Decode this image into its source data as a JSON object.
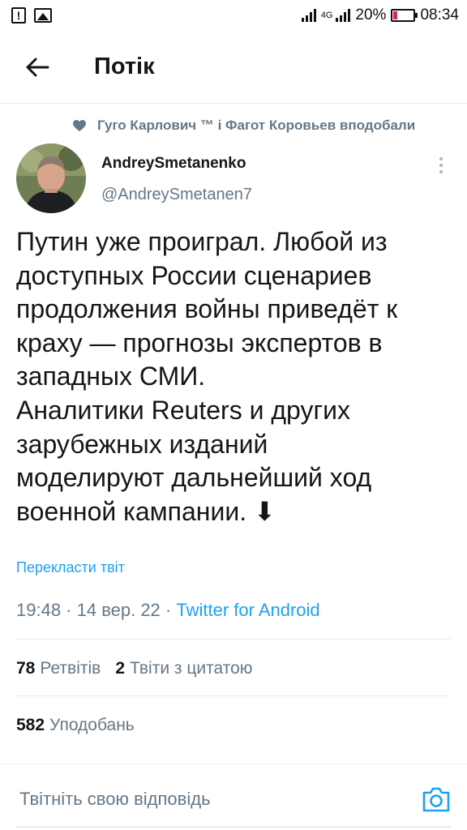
{
  "status_bar": {
    "network": "4G",
    "battery": "20%",
    "battery_level": 0.2,
    "time": "08:34"
  },
  "header": {
    "back_icon": "arrow-left-icon",
    "title": "Потік"
  },
  "social_context": {
    "icon": "heart-icon",
    "text": "Гуго Карлович ™ і Фагот Коровьев вподобали"
  },
  "tweet": {
    "author_name": "AndreySmetanenko",
    "author_handle": "@AndreySmetanen7",
    "text_lines": [
      "Путин уже проиграл. Любой из",
      "доступных России сценариев",
      "продолжения войны приведёт к",
      "краху — прогнозы экспертов в",
      "западных СМИ.",
      "Аналитики Reuters и других",
      "зарубежных изданий",
      "моделируют дальнейший ход",
      "военной кампании. ⬇"
    ],
    "translate_label": "Перекласти твіт",
    "timestamp": "19:48 · 14 вер. 22 · ",
    "source": "Twitter for Android"
  },
  "stats": {
    "retweets_count": "78",
    "retweets_label": "Ретвітів",
    "quotes_count": "2",
    "quotes_label": "Твіти з цитатою",
    "likes_count": "582",
    "likes_label": "Уподобань"
  },
  "reply": {
    "placeholder": "Твітніть свою відповідь",
    "camera_icon": "camera-icon"
  },
  "colors": {
    "accent": "#1da1f2",
    "secondary_text": "#657786",
    "primary_text": "#14171a",
    "divider": "#e6ecf0"
  }
}
